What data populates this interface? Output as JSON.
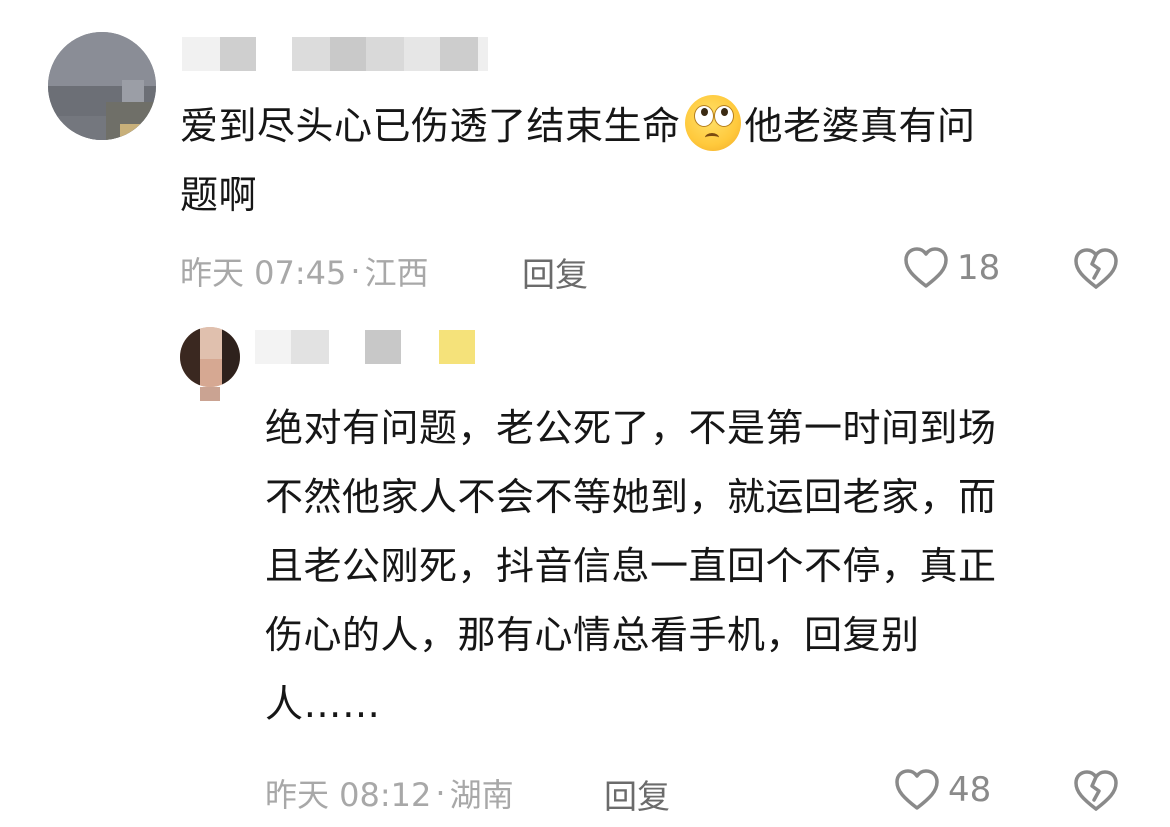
{
  "comments": [
    {
      "text_lines": [
        "爱到尽头心已伤透了结束生命",
        "他老婆真有问",
        "题啊"
      ],
      "emoji": "face-with-rolling-eyes-icon",
      "time": "昨天 07:45",
      "location": "江西",
      "reply_label": "回复",
      "like_count": "18"
    },
    {
      "text_lines": [
        "绝对有问题，老公死了，不是第一时间到场",
        "不然他家人不会不等她到，就运回老家，而",
        "且老公刚死，抖音信息一直回个不停，真正",
        "伤心的人，那有心情总看手机，回复别",
        "人……"
      ],
      "time": "昨天 08:12",
      "location": "湖南",
      "reply_label": "回复",
      "like_count": "48"
    }
  ],
  "separator": "·",
  "colors": {
    "text_primary": "#161616",
    "meta_gray": "#a8a8a8",
    "reply_gray": "#6b6b6b",
    "icon_gray": "#8a8a8a"
  }
}
